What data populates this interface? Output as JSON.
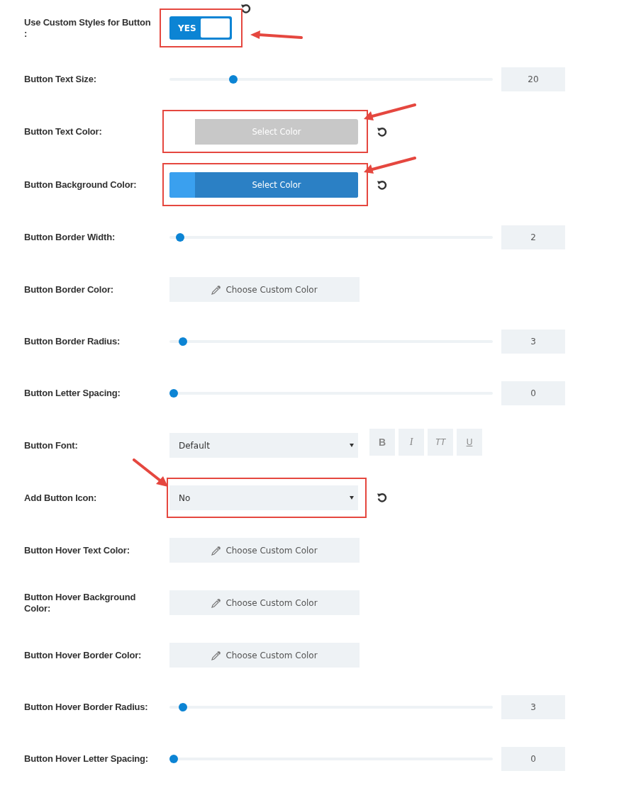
{
  "rows": [
    {
      "kind": "toggle",
      "label": "Use Custom Styles for Button :",
      "value": "YES",
      "on": true,
      "reset": true,
      "highlighted": true
    },
    {
      "kind": "slider",
      "label": "Button Text Size:",
      "level": 0.19,
      "value": "20"
    },
    {
      "kind": "color",
      "label": "Button Text Color:",
      "button": "Select Color",
      "active": false,
      "reset": true,
      "highlighted": true
    },
    {
      "kind": "color",
      "label": "Button Background Color:",
      "button": "Select Color",
      "active": true,
      "color": "#3aa0ef",
      "reset": true,
      "highlighted": true
    },
    {
      "kind": "slider",
      "label": "Button Border Width:",
      "level": 0.02,
      "value": "2"
    },
    {
      "kind": "custom_color",
      "label": "Button Border Color:",
      "button": "Choose Custom Color"
    },
    {
      "kind": "slider",
      "label": "Button Border Radius:",
      "level": 0.03,
      "value": "3"
    },
    {
      "kind": "slider",
      "label": "Button Letter Spacing:",
      "level": 0,
      "value": "0"
    },
    {
      "kind": "select",
      "label": "Button Font:",
      "value": "Default",
      "style_buttons": [
        {
          "label": "B",
          "kind": "bold"
        },
        {
          "label": "I",
          "kind": "italic"
        },
        {
          "label": "TT",
          "kind": "uppercase"
        },
        {
          "label": "U",
          "kind": "underline"
        }
      ]
    },
    {
      "kind": "select",
      "label": "Add Button Icon:",
      "value": "No",
      "reset": true,
      "highlighted": true
    },
    {
      "kind": "custom_color",
      "label": "Button Hover Text Color:",
      "button": "Choose Custom Color"
    },
    {
      "kind": "custom_color",
      "label": "Button Hover Background Color:",
      "button": "Choose Custom Color"
    },
    {
      "kind": "custom_color",
      "label": "Button Hover Border Color:",
      "button": "Choose Custom Color"
    },
    {
      "kind": "slider",
      "label": "Button Hover Border Radius:",
      "level": 0.03,
      "value": "3"
    },
    {
      "kind": "slider",
      "label": "Button Hover Letter Spacing:",
      "level": 0,
      "value": "0"
    }
  ]
}
